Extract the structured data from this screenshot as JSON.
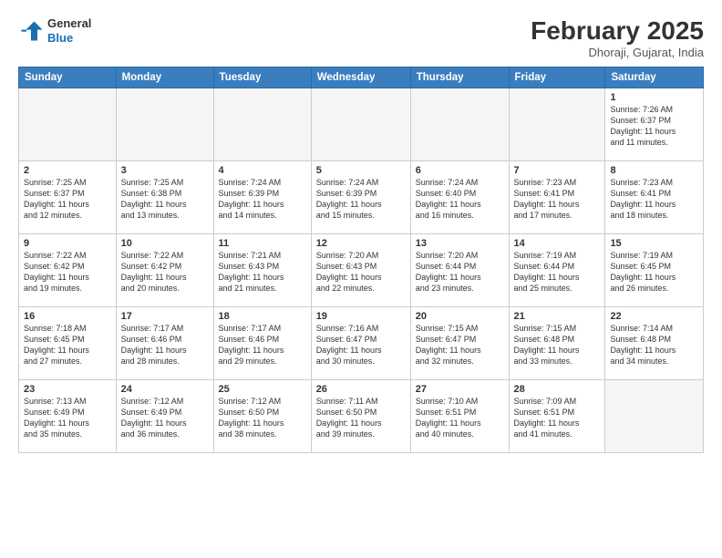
{
  "header": {
    "logo_line1": "General",
    "logo_line2": "Blue",
    "title": "February 2025",
    "location": "Dhoraji, Gujarat, India"
  },
  "days_of_week": [
    "Sunday",
    "Monday",
    "Tuesday",
    "Wednesday",
    "Thursday",
    "Friday",
    "Saturday"
  ],
  "weeks": [
    [
      {
        "day": "",
        "text": ""
      },
      {
        "day": "",
        "text": ""
      },
      {
        "day": "",
        "text": ""
      },
      {
        "day": "",
        "text": ""
      },
      {
        "day": "",
        "text": ""
      },
      {
        "day": "",
        "text": ""
      },
      {
        "day": "1",
        "text": "Sunrise: 7:26 AM\nSunset: 6:37 PM\nDaylight: 11 hours\nand 11 minutes."
      }
    ],
    [
      {
        "day": "2",
        "text": "Sunrise: 7:25 AM\nSunset: 6:37 PM\nDaylight: 11 hours\nand 12 minutes."
      },
      {
        "day": "3",
        "text": "Sunrise: 7:25 AM\nSunset: 6:38 PM\nDaylight: 11 hours\nand 13 minutes."
      },
      {
        "day": "4",
        "text": "Sunrise: 7:24 AM\nSunset: 6:39 PM\nDaylight: 11 hours\nand 14 minutes."
      },
      {
        "day": "5",
        "text": "Sunrise: 7:24 AM\nSunset: 6:39 PM\nDaylight: 11 hours\nand 15 minutes."
      },
      {
        "day": "6",
        "text": "Sunrise: 7:24 AM\nSunset: 6:40 PM\nDaylight: 11 hours\nand 16 minutes."
      },
      {
        "day": "7",
        "text": "Sunrise: 7:23 AM\nSunset: 6:41 PM\nDaylight: 11 hours\nand 17 minutes."
      },
      {
        "day": "8",
        "text": "Sunrise: 7:23 AM\nSunset: 6:41 PM\nDaylight: 11 hours\nand 18 minutes."
      }
    ],
    [
      {
        "day": "9",
        "text": "Sunrise: 7:22 AM\nSunset: 6:42 PM\nDaylight: 11 hours\nand 19 minutes."
      },
      {
        "day": "10",
        "text": "Sunrise: 7:22 AM\nSunset: 6:42 PM\nDaylight: 11 hours\nand 20 minutes."
      },
      {
        "day": "11",
        "text": "Sunrise: 7:21 AM\nSunset: 6:43 PM\nDaylight: 11 hours\nand 21 minutes."
      },
      {
        "day": "12",
        "text": "Sunrise: 7:20 AM\nSunset: 6:43 PM\nDaylight: 11 hours\nand 22 minutes."
      },
      {
        "day": "13",
        "text": "Sunrise: 7:20 AM\nSunset: 6:44 PM\nDaylight: 11 hours\nand 23 minutes."
      },
      {
        "day": "14",
        "text": "Sunrise: 7:19 AM\nSunset: 6:44 PM\nDaylight: 11 hours\nand 25 minutes."
      },
      {
        "day": "15",
        "text": "Sunrise: 7:19 AM\nSunset: 6:45 PM\nDaylight: 11 hours\nand 26 minutes."
      }
    ],
    [
      {
        "day": "16",
        "text": "Sunrise: 7:18 AM\nSunset: 6:45 PM\nDaylight: 11 hours\nand 27 minutes."
      },
      {
        "day": "17",
        "text": "Sunrise: 7:17 AM\nSunset: 6:46 PM\nDaylight: 11 hours\nand 28 minutes."
      },
      {
        "day": "18",
        "text": "Sunrise: 7:17 AM\nSunset: 6:46 PM\nDaylight: 11 hours\nand 29 minutes."
      },
      {
        "day": "19",
        "text": "Sunrise: 7:16 AM\nSunset: 6:47 PM\nDaylight: 11 hours\nand 30 minutes."
      },
      {
        "day": "20",
        "text": "Sunrise: 7:15 AM\nSunset: 6:47 PM\nDaylight: 11 hours\nand 32 minutes."
      },
      {
        "day": "21",
        "text": "Sunrise: 7:15 AM\nSunset: 6:48 PM\nDaylight: 11 hours\nand 33 minutes."
      },
      {
        "day": "22",
        "text": "Sunrise: 7:14 AM\nSunset: 6:48 PM\nDaylight: 11 hours\nand 34 minutes."
      }
    ],
    [
      {
        "day": "23",
        "text": "Sunrise: 7:13 AM\nSunset: 6:49 PM\nDaylight: 11 hours\nand 35 minutes."
      },
      {
        "day": "24",
        "text": "Sunrise: 7:12 AM\nSunset: 6:49 PM\nDaylight: 11 hours\nand 36 minutes."
      },
      {
        "day": "25",
        "text": "Sunrise: 7:12 AM\nSunset: 6:50 PM\nDaylight: 11 hours\nand 38 minutes."
      },
      {
        "day": "26",
        "text": "Sunrise: 7:11 AM\nSunset: 6:50 PM\nDaylight: 11 hours\nand 39 minutes."
      },
      {
        "day": "27",
        "text": "Sunrise: 7:10 AM\nSunset: 6:51 PM\nDaylight: 11 hours\nand 40 minutes."
      },
      {
        "day": "28",
        "text": "Sunrise: 7:09 AM\nSunset: 6:51 PM\nDaylight: 11 hours\nand 41 minutes."
      },
      {
        "day": "",
        "text": ""
      }
    ]
  ]
}
